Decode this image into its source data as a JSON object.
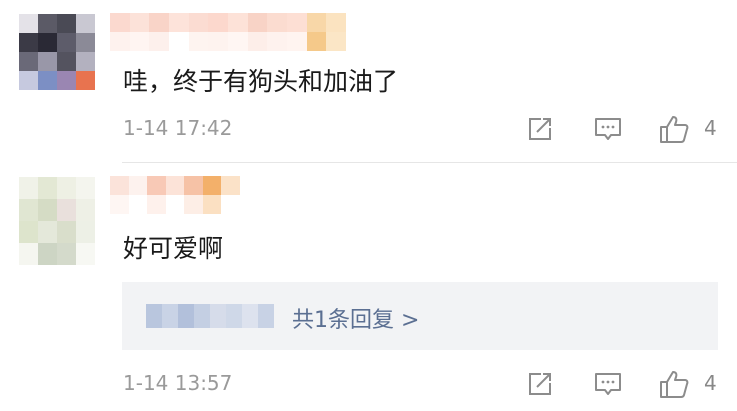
{
  "comments": [
    {
      "text": "哇，终于有狗头和加油了",
      "time": "1-14 17:42",
      "likes": "4",
      "avatar_pixels": [
        "#e4e2e8",
        "#5b5a66",
        "#4a4a55",
        "#c9c8d2",
        "#3b3a46",
        "#2a2935",
        "#5d5c6a",
        "#8b8a97",
        "#6a6978",
        "#9997a8",
        "#54535f",
        "#b3b1bf",
        "#c6c9df",
        "#7c8fc4",
        "#9a86b2",
        "#e8734f"
      ],
      "name_pixels": [
        "#fbd9cf",
        "#fce2d9",
        "#f9d4c8",
        "#fde3da",
        "#fbdcd2",
        "#fcd8cd",
        "#fde2d8",
        "#f8d3c6",
        "#fbdcd0",
        "#fddfd4",
        "#f8d7a8",
        "#fbe3c0",
        "#fef2ee",
        "#fff5f2",
        "#fdf0ec",
        "#ffffff",
        "#fef4f0",
        "#fef3ef",
        "#fff6f3",
        "#fdeee9",
        "#fef2ee",
        "#fff4f0",
        "#f5c98a",
        "#fbe6c6"
      ]
    },
    {
      "text": "好可爱啊",
      "time": "1-14 13:57",
      "likes": "4",
      "reply_link": "共1条回复 >",
      "avatar_pixels": [
        "#f0f2e8",
        "#e3e8d4",
        "#eef0e4",
        "#f4f5ee",
        "#e0e6d2",
        "#d5dcc5",
        "#e9e0dc",
        "#eef0e6",
        "#dde4cc",
        "#e4e8da",
        "#d9decb",
        "#edf0e6",
        "#f5f6f0",
        "#cdd5c4",
        "#d4dacb",
        "#f7f8f3"
      ],
      "name_pixels": [
        "#fbe3da",
        "#fdf2ee",
        "#f8c9b6",
        "#fce3d8",
        "#f6c2a6",
        "#f3b06a",
        "#fbe2c8",
        "#fef6f3",
        "#ffffff",
        "#fef1ec",
        "#ffffff",
        "#fdeee6",
        "#fbe0c2",
        "#ffffff"
      ],
      "reply_blur_pixels": [
        "#b9c6de",
        "#c9d3e6",
        "#b2c0db",
        "#c4cfe3",
        "#d6dcea",
        "#cfd8e8",
        "#dde2ee",
        "#c8d2e5"
      ]
    }
  ],
  "icons": {
    "share": "share-icon",
    "comment": "comment-icon",
    "like": "thumbs-up-icon"
  },
  "colors": {
    "meta": "#9a9a9a",
    "link": "#5b6f92",
    "reply_bg": "#f2f3f5",
    "icon": "#8c8c8c"
  }
}
